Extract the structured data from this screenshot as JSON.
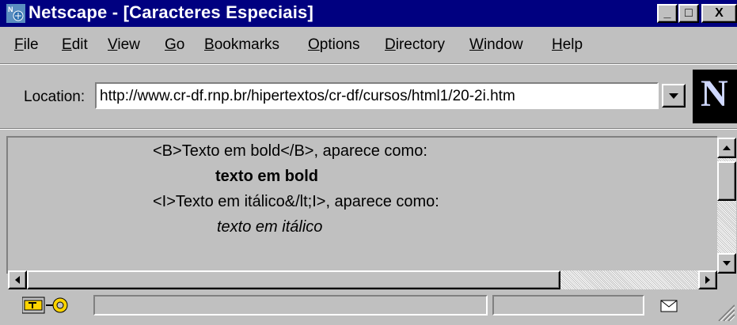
{
  "window": {
    "title": "Netscape - [Caracteres Especiais]",
    "controls": {
      "minimize": "_",
      "maximize": "□",
      "close": "X"
    }
  },
  "menu": {
    "items": [
      "File",
      "Edit",
      "View",
      "Go",
      "Bookmarks",
      "Options",
      "Directory",
      "Window",
      "Help"
    ]
  },
  "location": {
    "label": "Location:",
    "url": "http://www.cr-df.rnp.br/hipertextos/cr-df/cursos/html1/20-2i.htm"
  },
  "logo": {
    "letter": "N"
  },
  "content": {
    "lines": [
      "<B>Texto em bold</B>, aparece como:",
      "texto em bold",
      "<I>Texto em itálico&/lt;I>, aparece como:",
      "texto em itálico"
    ]
  },
  "icons": {
    "app": "netscape-app-icon",
    "security": "security-key-icon",
    "mail": "mail-envelope-icon"
  }
}
